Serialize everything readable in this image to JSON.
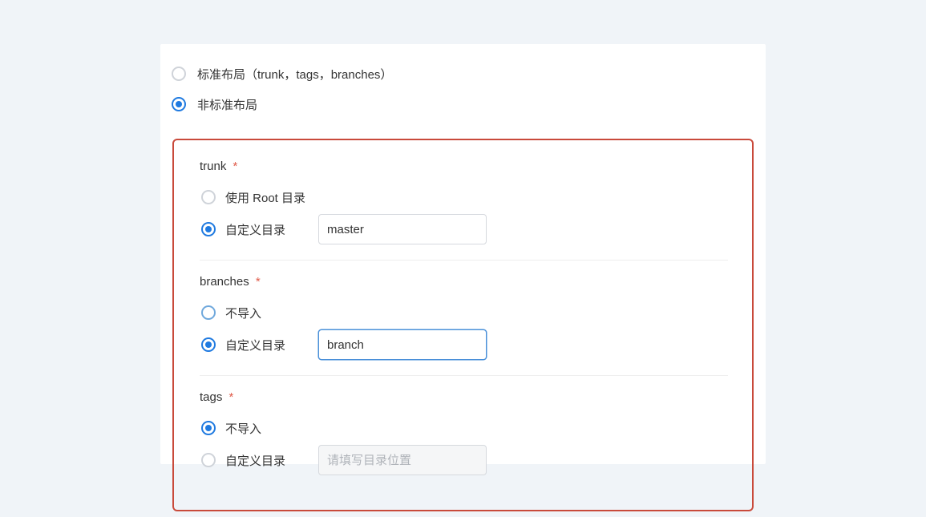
{
  "layout": {
    "standard_label": "标准布局（trunk，tags，branches）",
    "nonstandard_label": "非标准布局"
  },
  "trunk": {
    "title": "trunk",
    "use_root_label": "使用 Root 目录",
    "custom_label": "自定义目录",
    "custom_value": "master"
  },
  "branches": {
    "title": "branches",
    "skip_label": "不导入",
    "custom_label": "自定义目录",
    "custom_value": "branch"
  },
  "tags": {
    "title": "tags",
    "skip_label": "不导入",
    "custom_label": "自定义目录",
    "custom_placeholder": "请填写目录位置"
  }
}
